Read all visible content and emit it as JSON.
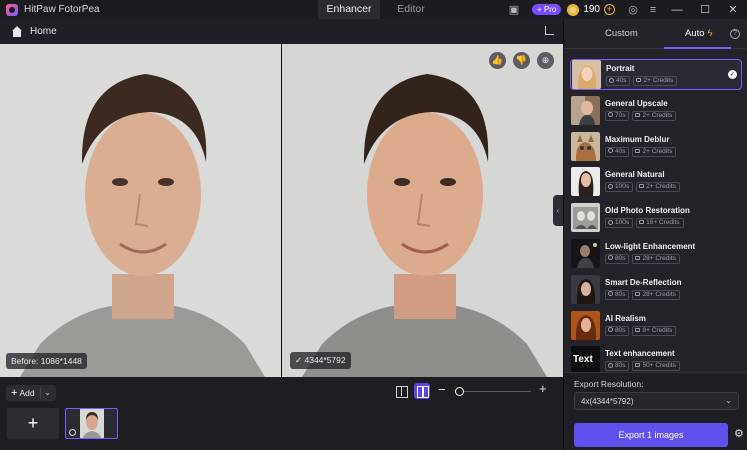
{
  "app": {
    "title": "HitPaw FotorPea"
  },
  "tabs": [
    {
      "label": "Enhancer",
      "active": true
    },
    {
      "label": "Editor",
      "active": false
    }
  ],
  "titlebar": {
    "pro_label": "+ Pro",
    "credits": "190",
    "minimize": "—",
    "maximize": "☐",
    "close": "✕"
  },
  "homebar": {
    "home_label": "Home"
  },
  "panes": {
    "before_label": "Before: 1086*1448",
    "after_label": "4344*5792"
  },
  "toolbar": {
    "add_label": "Add"
  },
  "panel": {
    "tab_custom": "Custom",
    "tab_auto": "Auto",
    "models": [
      {
        "name": "Portrait",
        "time": "40s",
        "credits": "2+ Credits",
        "selected": true
      },
      {
        "name": "General Upscale",
        "time": "70s",
        "credits": "2+ Credits"
      },
      {
        "name": "Maximum Deblur",
        "time": "40s",
        "credits": "2+ Credits"
      },
      {
        "name": "General Natural",
        "time": "100s",
        "credits": "2+ Credits"
      },
      {
        "name": "Old Photo Restoration",
        "time": "100s",
        "credits": "16+ Credits"
      },
      {
        "name": "Low-light Enhancement",
        "time": "80s",
        "credits": "28+ Credits"
      },
      {
        "name": "Smart De-Reflection",
        "time": "80s",
        "credits": "28+ Credits"
      },
      {
        "name": "AI Realism",
        "time": "80s",
        "credits": "8+ Credits"
      },
      {
        "name": "Text enhancement",
        "time": "80s",
        "credits": "50+ Credits",
        "thumb_text": "Text"
      }
    ]
  },
  "export": {
    "resolution_label": "Export Resolution:",
    "resolution_value": "4x(4344*5792)",
    "button_label": "Export 1 images"
  },
  "colors": {
    "accent": "#6150EE",
    "selection": "#7B5CFF",
    "background": "#141418",
    "panel": "#232329"
  }
}
